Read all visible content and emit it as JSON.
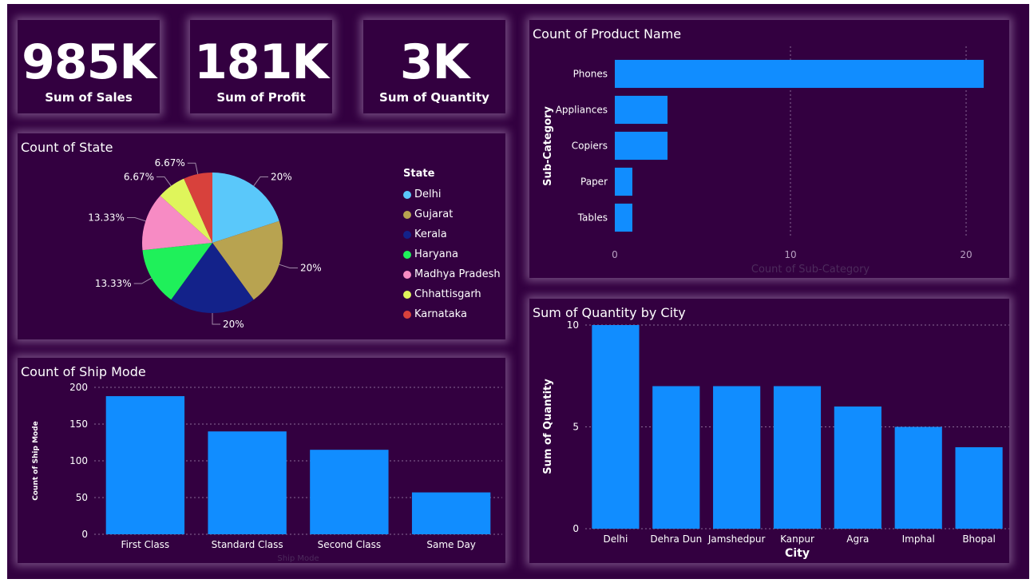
{
  "kpis": {
    "sales": {
      "value": "985K",
      "label": "Sum of Sales"
    },
    "profit": {
      "value": "181K",
      "label": "Sum of Profit"
    },
    "quantity": {
      "value": "3K",
      "label": "Sum of Quantity"
    }
  },
  "colors": {
    "bar": "#118dff",
    "background": "#330040"
  },
  "chart_data": [
    {
      "id": "state",
      "type": "pie",
      "title": "Count of State",
      "legend_title": "State",
      "legend_position": "right",
      "labels": [
        "Delhi",
        "Gujarat",
        "Kerala",
        "Haryana",
        "Madhya Pradesh",
        "Chhattisgarh",
        "Karnataka"
      ],
      "values": [
        20,
        20,
        20,
        13.33,
        13.33,
        6.67,
        6.67
      ],
      "value_labels": [
        "20%",
        "20%",
        "20%",
        "13.33%",
        "13.33%",
        "6.67%",
        "6.67%"
      ],
      "colors": [
        "#5ac8fa",
        "#b8a350",
        "#13228a",
        "#1ff05a",
        "#f78bc4",
        "#dff55b",
        "#d8413c"
      ]
    },
    {
      "id": "product",
      "type": "bar",
      "orientation": "horizontal",
      "title": "Count of Product Name",
      "xlabel": "Count of Sub-Category",
      "ylabel": "Sub-Category",
      "categories": [
        "Phones",
        "Appliances",
        "Copiers",
        "Paper",
        "Tables"
      ],
      "values": [
        21,
        3,
        3,
        1,
        1
      ],
      "xlim": [
        0,
        22
      ],
      "ticks": [
        "0",
        "10",
        "20"
      ],
      "tick_values": [
        0,
        10,
        20
      ],
      "grid": true
    },
    {
      "id": "shipmode",
      "type": "bar",
      "title": "Count of Ship Mode",
      "xlabel": "Ship Mode",
      "ylabel": "Count of Ship Mode",
      "categories": [
        "First Class",
        "Standard Class",
        "Second Class",
        "Same Day"
      ],
      "values": [
        188,
        140,
        115,
        57
      ],
      "ylim": [
        0,
        200
      ],
      "ticks": [
        "0",
        "50",
        "100",
        "150",
        "200"
      ],
      "tick_values": [
        0,
        50,
        100,
        150,
        200
      ],
      "grid": true
    },
    {
      "id": "city",
      "type": "bar",
      "title": "Sum of Quantity by City",
      "xlabel": "City",
      "ylabel": "Sum of Quantity",
      "categories": [
        "Delhi",
        "Dehra Dun",
        "Jamshedpur",
        "Kanpur",
        "Agra",
        "Imphal",
        "Bhopal"
      ],
      "values": [
        10,
        7,
        7,
        7,
        6,
        5,
        4
      ],
      "ylim": [
        0,
        10
      ],
      "ticks": [
        "0",
        "5",
        "10"
      ],
      "tick_values": [
        0,
        5,
        10
      ],
      "grid": true
    }
  ]
}
